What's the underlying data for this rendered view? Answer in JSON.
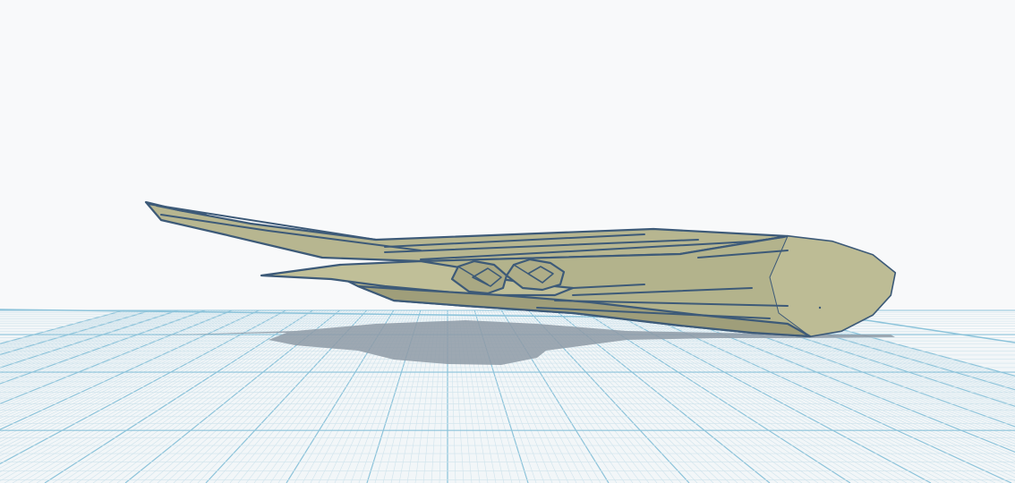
{
  "scene": {
    "type": "3d-workplane-view",
    "model": "airplane-mesh",
    "colors": {
      "background": "#f8f9fa",
      "workplane": "#f2f6f8",
      "grid_minor": "#cfe3ec",
      "grid_major": "#8cc3da",
      "model_fill": "#b4b48e",
      "model_light": "#c3c29b",
      "model_dark": "#8f8e6c",
      "model_edge": "#3d5a78",
      "shadow": "#8e9aa6"
    }
  }
}
